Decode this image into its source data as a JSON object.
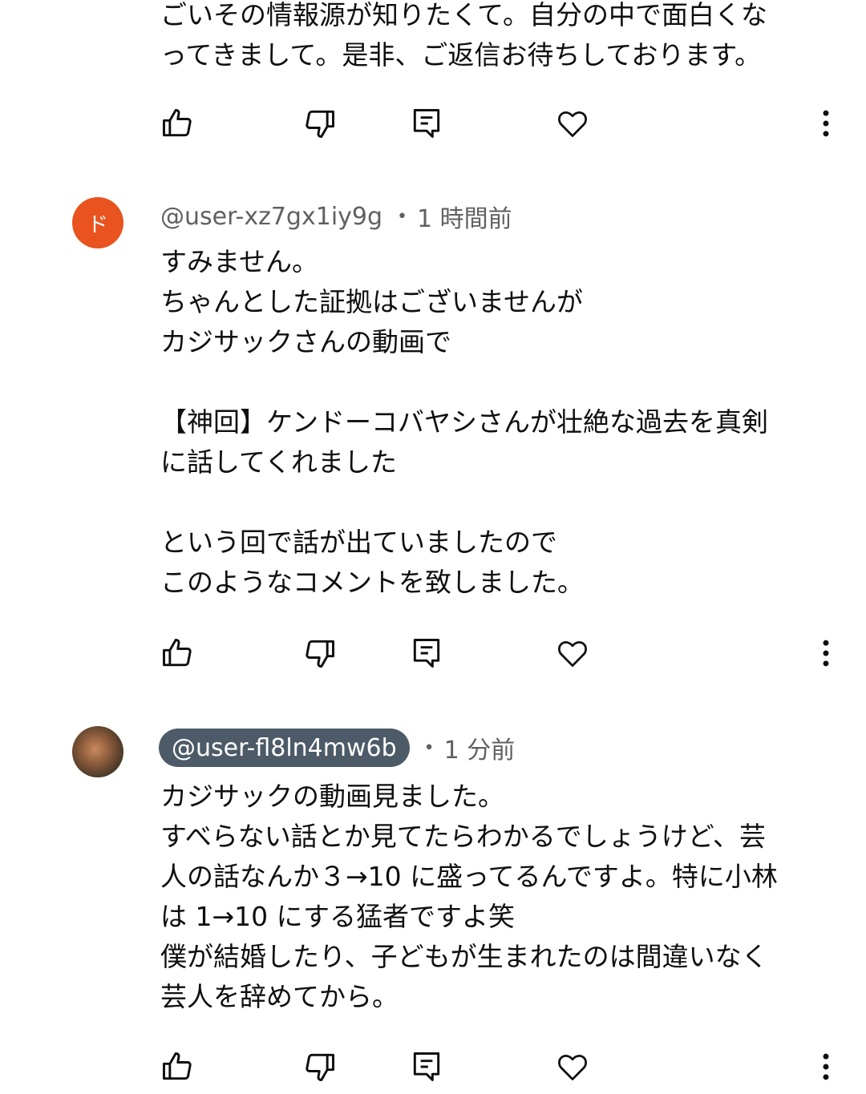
{
  "comments": [
    {
      "lines": "ごいその情報源が知りたくて。自分の中で面白くな\nってきまして。是非、ご返信お待ちしております。"
    },
    {
      "avatar_initial": "ド",
      "handle": "@user-xz7gx1iy9g",
      "time": "1 時間前",
      "lines": "すみません。\nちゃんとした証拠はございませんが\nカジサックさんの動画で\n\n【神回】ケンドーコバヤシさんが壮絶な過去を真剣\nに話してくれました\n\nという回で話が出ていましたので\nこのようなコメントを致しました。"
    },
    {
      "handle": "@user-fl8ln4mw6b",
      "time": "1 分前",
      "lines": "カジサックの動画見ました。\nすべらない話とか見てたらわかるでしょうけど、芸\n人の話なんか３→10 に盛ってるんですよ。特に小林\nは 1→10 にする猛者ですよ笑\n僕が結婚したり、子どもが生まれたのは間違いなく\n芸人を辞めてから。"
    }
  ],
  "icons": {
    "like": "thumbs-up-icon",
    "dislike": "thumbs-down-icon",
    "reply": "reply-comment-icon",
    "heart": "heart-icon",
    "more": "more-vertical-icon"
  },
  "colors": {
    "avatar_orange": "#e8531f",
    "handle_pill": "#4d5a68",
    "meta_gray": "#606060",
    "text": "#0f0f0f"
  }
}
